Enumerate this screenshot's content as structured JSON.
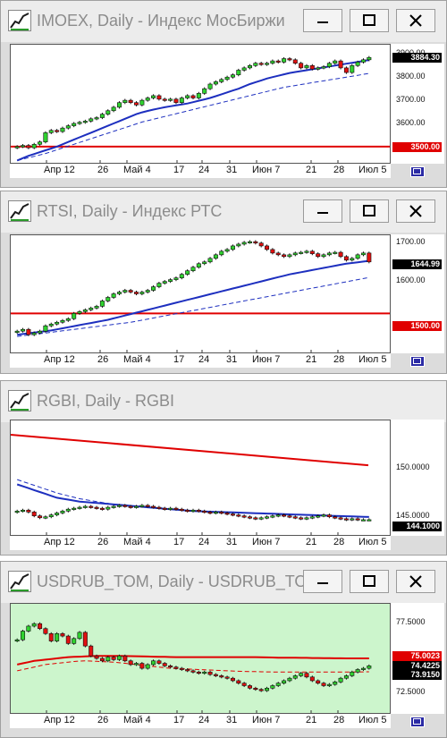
{
  "windows": [
    {
      "title": "IMOEX, Daily - Индекс МосБиржи",
      "bg": "#ffffff",
      "y_labels": [
        "3900.00",
        "3800.00",
        "3700.00",
        "3600.00"
      ],
      "y_ticks": [
        3900,
        3800,
        3700,
        3600
      ],
      "y_range": [
        3430,
        3940
      ],
      "last_price": "3884.30",
      "last_value": 3884.3,
      "level_label": "3500.00",
      "level_value": 3500,
      "closes": [
        3500,
        3505,
        3495,
        3510,
        3520,
        3560,
        3570,
        3565,
        3580,
        3590,
        3600,
        3605,
        3610,
        3620,
        3625,
        3640,
        3655,
        3670,
        3690,
        3700,
        3690,
        3680,
        3700,
        3710,
        3720,
        3705,
        3700,
        3705,
        3690,
        3710,
        3720,
        3710,
        3730,
        3750,
        3770,
        3780,
        3790,
        3800,
        3810,
        3830,
        3840,
        3850,
        3860,
        3855,
        3860,
        3870,
        3865,
        3880,
        3875,
        3860,
        3840,
        3850,
        3835,
        3840,
        3845,
        3860,
        3870,
        3840,
        3820,
        3850,
        3865,
        3875,
        3885
      ],
      "ma_fast": [
        3440,
        3450,
        3460,
        3468,
        3476,
        3484,
        3492,
        3500,
        3510,
        3520,
        3530,
        3540,
        3550,
        3560,
        3570,
        3580,
        3590,
        3600,
        3610,
        3620,
        3630,
        3640,
        3648,
        3654,
        3660,
        3665,
        3670,
        3674,
        3678,
        3682,
        3686,
        3692,
        3698,
        3704,
        3710,
        3718,
        3726,
        3734,
        3742,
        3750,
        3760,
        3770,
        3778,
        3786,
        3794,
        3800,
        3806,
        3812,
        3818,
        3822,
        3826,
        3830,
        3834,
        3838,
        3842,
        3846,
        3850,
        3854,
        3858,
        3862,
        3866,
        3870,
        3874
      ],
      "ma_slow": [
        3440,
        3446,
        3452,
        3458,
        3464,
        3470,
        3478,
        3486,
        3494,
        3502,
        3510,
        3518,
        3526,
        3534,
        3542,
        3550,
        3558,
        3566,
        3574,
        3582,
        3590,
        3598,
        3606,
        3612,
        3618,
        3624,
        3630,
        3636,
        3642,
        3648,
        3654,
        3660,
        3666,
        3672,
        3678,
        3684,
        3690,
        3696,
        3702,
        3708,
        3714,
        3720,
        3726,
        3732,
        3738,
        3744,
        3750,
        3756,
        3760,
        3764,
        3768,
        3772,
        3776,
        3780,
        3784,
        3788,
        3792,
        3796,
        3800,
        3804,
        3808,
        3812,
        3816
      ],
      "x_labels": [
        "Апр 12",
        "26",
        "Май 4",
        "17",
        "24",
        "31",
        "Июн 7",
        "21",
        "28",
        "Июл 5"
      ]
    },
    {
      "title": "RTSI, Daily - Индекс РТС",
      "bg": "#ffffff",
      "y_labels": [
        "1700.00",
        "1600.00"
      ],
      "y_ticks": [
        1700,
        1600
      ],
      "y_range": [
        1390,
        1720
      ],
      "last_price": "1644.99",
      "last_value": 1644.99,
      "level_label": "1500.00",
      "level_value": 1500,
      "closes": [
        1450,
        1455,
        1440,
        1445,
        1450,
        1465,
        1470,
        1475,
        1480,
        1485,
        1500,
        1505,
        1510,
        1515,
        1520,
        1535,
        1545,
        1555,
        1560,
        1565,
        1560,
        1555,
        1560,
        1565,
        1575,
        1585,
        1590,
        1595,
        1600,
        1610,
        1620,
        1630,
        1640,
        1645,
        1655,
        1665,
        1675,
        1680,
        1690,
        1695,
        1700,
        1702,
        1698,
        1690,
        1680,
        1670,
        1665,
        1660,
        1665,
        1670,
        1672,
        1675,
        1668,
        1660,
        1665,
        1670,
        1672,
        1660,
        1650,
        1655,
        1665,
        1670,
        1645
      ],
      "ma_fast": [
        1440,
        1442,
        1444,
        1446,
        1448,
        1450,
        1452,
        1455,
        1458,
        1461,
        1464,
        1467,
        1470,
        1473,
        1476,
        1479,
        1482,
        1486,
        1490,
        1494,
        1498,
        1502,
        1506,
        1510,
        1514,
        1518,
        1522,
        1526,
        1530,
        1534,
        1538,
        1542,
        1546,
        1550,
        1554,
        1558,
        1562,
        1566,
        1570,
        1574,
        1578,
        1582,
        1586,
        1590,
        1594,
        1598,
        1602,
        1606,
        1610,
        1613,
        1616,
        1619,
        1622,
        1625,
        1628,
        1631,
        1634,
        1637,
        1640,
        1642,
        1644,
        1646,
        1648
      ],
      "ma_slow": [
        1435,
        1437,
        1439,
        1441,
        1443,
        1445,
        1447,
        1449,
        1451,
        1453,
        1455,
        1457,
        1459,
        1461,
        1463,
        1465,
        1467,
        1469,
        1471,
        1473,
        1475,
        1478,
        1481,
        1484,
        1487,
        1490,
        1493,
        1496,
        1499,
        1502,
        1505,
        1508,
        1511,
        1514,
        1517,
        1520,
        1523,
        1526,
        1529,
        1532,
        1535,
        1538,
        1541,
        1544,
        1547,
        1550,
        1553,
        1556,
        1559,
        1562,
        1565,
        1568,
        1571,
        1574,
        1577,
        1580,
        1583,
        1586,
        1589,
        1592,
        1595,
        1598,
        1601
      ],
      "x_labels": [
        "Апр 12",
        "26",
        "Май 4",
        "17",
        "24",
        "31",
        "Июн 7",
        "21",
        "28",
        "Июл 5"
      ]
    },
    {
      "title": "RGBI, Daily - RGBI",
      "bg": "#ffffff",
      "y_labels": [
        "150.0000",
        "145.0000"
      ],
      "y_ticks": [
        150,
        145
      ],
      "y_range": [
        142.5,
        154.5
      ],
      "last_price": "144.1000",
      "last_value": 144.1,
      "level_label": "",
      "level_value": null,
      "closes": [
        145,
        145.1,
        144.9,
        144.5,
        144.3,
        144.4,
        144.6,
        144.8,
        145.0,
        145.2,
        145.3,
        145.4,
        145.5,
        145.4,
        145.3,
        145.2,
        145.4,
        145.5,
        145.6,
        145.5,
        145.4,
        145.5,
        145.6,
        145.5,
        145.4,
        145.3,
        145.2,
        145.3,
        145.2,
        145.1,
        145.0,
        145.1,
        145.0,
        144.9,
        144.8,
        144.9,
        144.8,
        144.7,
        144.6,
        144.5,
        144.4,
        144.3,
        144.2,
        144.3,
        144.4,
        144.5,
        144.6,
        144.5,
        144.4,
        144.3,
        144.2,
        144.3,
        144.4,
        144.5,
        144.6,
        144.4,
        144.3,
        144.2,
        144.1,
        144.2,
        144.1,
        144.1,
        144.1
      ],
      "ma_fast": [
        147.8,
        147.6,
        147.4,
        147.2,
        147.0,
        146.8,
        146.6,
        146.4,
        146.3,
        146.2,
        146.1,
        146.0,
        145.95,
        145.9,
        145.85,
        145.8,
        145.75,
        145.7,
        145.65,
        145.6,
        145.55,
        145.5,
        145.45,
        145.4,
        145.35,
        145.3,
        145.25,
        145.2,
        145.15,
        145.1,
        145.05,
        145.0,
        144.98,
        144.96,
        144.94,
        144.92,
        144.9,
        144.88,
        144.86,
        144.84,
        144.82,
        144.8,
        144.78,
        144.76,
        144.74,
        144.72,
        144.7,
        144.68,
        144.66,
        144.64,
        144.62,
        144.6,
        144.58,
        144.56,
        144.54,
        144.52,
        144.5,
        144.48,
        144.46,
        144.44,
        144.42,
        144.4,
        144.38
      ],
      "ma_slow": [
        148.3,
        148.1,
        147.9,
        147.7,
        147.5,
        147.3,
        147.1,
        146.9,
        146.75,
        146.6,
        146.45,
        146.3,
        146.2,
        146.1,
        146.0,
        145.9,
        145.8,
        145.7,
        145.65,
        145.6,
        145.55,
        145.5,
        145.45,
        145.4,
        145.35,
        145.3,
        145.25,
        145.2,
        145.15,
        145.1,
        145.05,
        145.0,
        144.98,
        144.96,
        144.94,
        144.92,
        144.9,
        144.88,
        144.86,
        144.84,
        144.82,
        144.8,
        144.78,
        144.76,
        144.74,
        144.72,
        144.7,
        144.68,
        144.66,
        144.64,
        144.62,
        144.6,
        144.58,
        144.56,
        144.54,
        144.52,
        144.5,
        144.48,
        144.46,
        144.44,
        144.42,
        144.4,
        144.38
      ],
      "red_line": [
        153.0,
        149.8
      ],
      "x_labels": [
        "Апр 12",
        "26",
        "Май 4",
        "17",
        "24",
        "31",
        "Июн 7",
        "21",
        "28",
        "Июл 5"
      ]
    },
    {
      "title": "USDRUB_TOM, Daily - USDRUB_TOM",
      "bg": "#ccf5cc",
      "y_labels": [
        "77.5000",
        "72.5000"
      ],
      "y_ticks": [
        77.5,
        72.5
      ],
      "y_range": [
        70.6,
        79.4
      ],
      "last_price": "74.4225",
      "last_value": 74.4225,
      "level_label": "",
      "level_value": null,
      "tags": [
        {
          "text": "75.0023",
          "value": 75.0023,
          "color": "#e00000"
        },
        {
          "text": "74.4225",
          "value": 74.4225,
          "color": "#000000"
        },
        {
          "text": "73.9150",
          "value": 73.915,
          "color": "#000000"
        }
      ],
      "closes": [
        76.5,
        77.2,
        77.6,
        77.8,
        77.4,
        77.0,
        76.4,
        77.0,
        76.8,
        76.2,
        76.6,
        77.1,
        76.0,
        75.2,
        75.0,
        74.8,
        75.1,
        74.9,
        75.2,
        74.8,
        74.5,
        74.6,
        74.2,
        74.5,
        74.8,
        74.6,
        74.4,
        74.3,
        74.2,
        74.1,
        74.0,
        73.9,
        73.8,
        73.9,
        73.7,
        73.6,
        73.5,
        73.4,
        73.2,
        73.0,
        72.8,
        72.6,
        72.5,
        72.4,
        72.6,
        72.8,
        73.0,
        73.2,
        73.4,
        73.6,
        73.8,
        73.5,
        73.2,
        73.0,
        72.8,
        72.9,
        73.1,
        73.4,
        73.6,
        73.9,
        74.1,
        74.2,
        74.4
      ],
      "ma_fast": [
        74.5,
        74.6,
        74.7,
        74.8,
        74.85,
        74.9,
        74.95,
        75.0,
        75.05,
        75.1,
        75.12,
        75.14,
        75.16,
        75.18,
        75.2,
        75.2,
        75.2,
        75.2,
        75.2,
        75.19,
        75.18,
        75.17,
        75.16,
        75.15,
        75.14,
        75.13,
        75.12,
        75.11,
        75.1,
        75.1,
        75.1,
        75.1,
        75.1,
        75.1,
        75.1,
        75.1,
        75.1,
        75.1,
        75.1,
        75.1,
        75.1,
        75.1,
        75.1,
        75.09,
        75.08,
        75.07,
        75.06,
        75.05,
        75.05,
        75.05,
        75.04,
        75.04,
        75.03,
        75.03,
        75.02,
        75.02,
        75.01,
        75.01,
        75.0,
        75.0,
        75.0,
        75.0,
        75.0
      ],
      "ma_slow": [
        74.0,
        74.1,
        74.2,
        74.3,
        74.4,
        74.5,
        74.55,
        74.6,
        74.65,
        74.7,
        74.75,
        74.78,
        74.8,
        74.78,
        74.76,
        74.74,
        74.72,
        74.7,
        74.65,
        74.6,
        74.55,
        74.5,
        74.45,
        74.4,
        74.35,
        74.3,
        74.25,
        74.2,
        74.18,
        74.16,
        74.14,
        74.12,
        74.1,
        74.08,
        74.06,
        74.04,
        74.02,
        74.0,
        73.98,
        73.96,
        73.95,
        73.94,
        73.93,
        73.92,
        73.91,
        73.9,
        73.9,
        73.9,
        73.9,
        73.9,
        73.9,
        73.9,
        73.9,
        73.9,
        73.9,
        73.9,
        73.9,
        73.9,
        73.9,
        73.9,
        73.91,
        73.91,
        73.92
      ],
      "x_labels": [
        "Апр 12",
        "26",
        "Май 4",
        "17",
        "24",
        "31",
        "Июн 7",
        "21",
        "28",
        "Июл 5"
      ]
    }
  ],
  "colors": {
    "bull": "#2fd12f",
    "bear": "#e01010",
    "ma": "#1d2fbf",
    "level": "#e00000",
    "title_text": "#8c8c8c",
    "corner_button": "#2b2ba5"
  },
  "icons": [
    "chart-app-icon",
    "minimize-icon",
    "maximize-icon",
    "close-icon"
  ]
}
